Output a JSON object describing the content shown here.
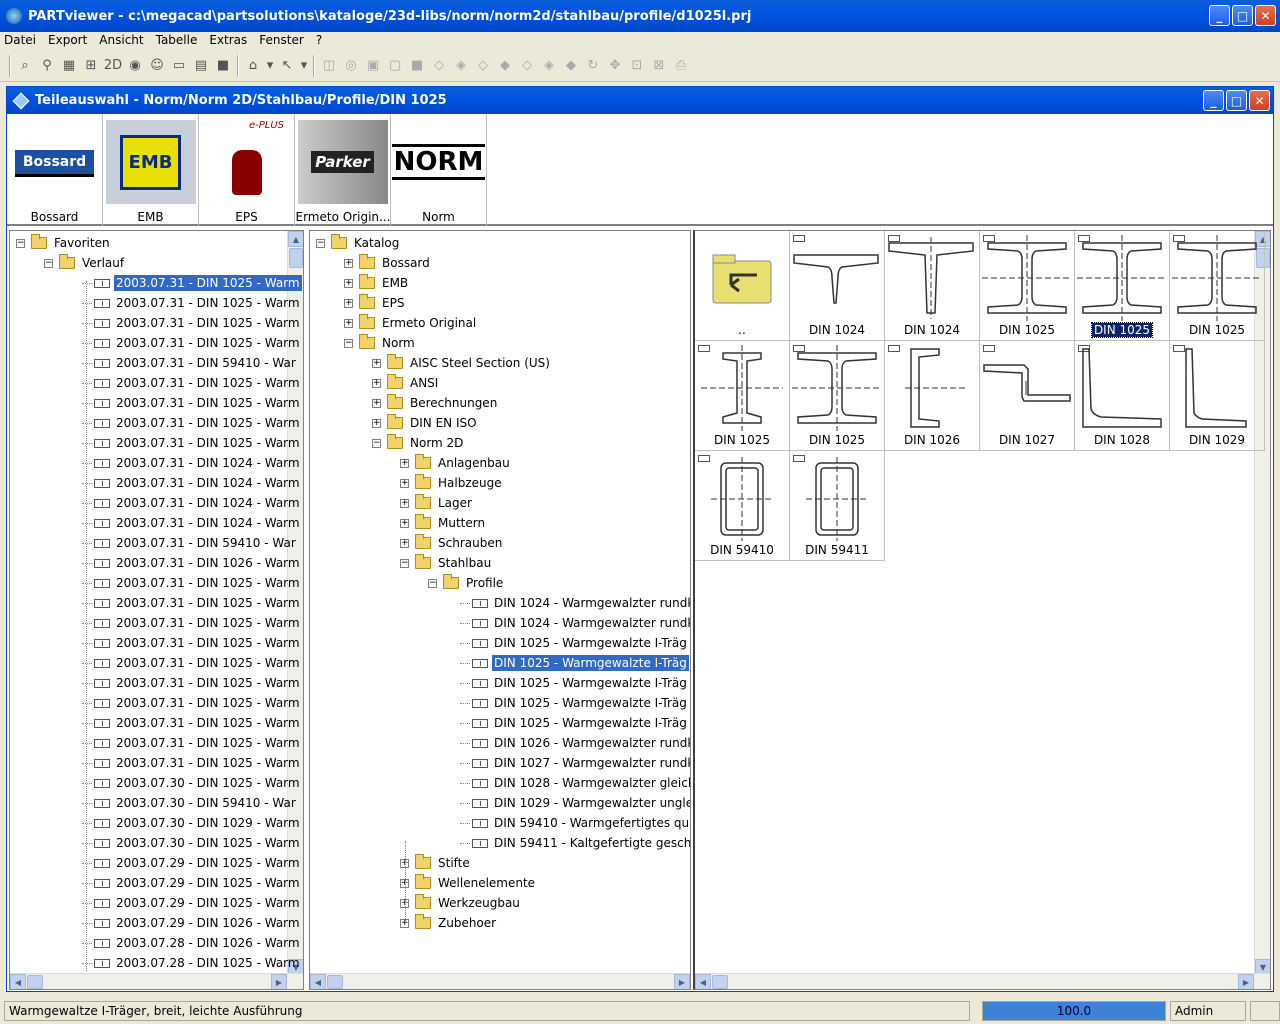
{
  "app": {
    "title": "PARTviewer - c:\\megacad\\partsolutions\\kataloge/23d-libs/norm/norm2d/stahlbau/profile/d1025l.prj"
  },
  "menu": [
    "Datei",
    "Export",
    "Ansicht",
    "Tabelle",
    "Extras",
    "Fenster",
    "?"
  ],
  "toolbar": {
    "icons": [
      "binoculars-icon",
      "filter-icon",
      "table-icon",
      "grid-icon",
      "2d-icon",
      "globe-icon",
      "person-icon",
      "disk-icon",
      "table2-icon",
      "stop-icon",
      "cad-icon",
      "dropdown-icon",
      "cursor-icon",
      "dropdown2-icon",
      "cylinder-icon",
      "cylinder2-icon",
      "box-icon",
      "box2-icon",
      "box3-icon",
      "view1-icon",
      "view2-icon",
      "view3-icon",
      "view4-icon",
      "view5-icon",
      "view6-icon",
      "view7-icon",
      "rotate-icon",
      "pan-icon",
      "zoom-window-icon",
      "zoom-all-icon",
      "print-icon"
    ]
  },
  "child_window": {
    "title": "Teileauswahl  -  Norm/Norm 2D/Stahlbau/Profile/DIN 1025"
  },
  "catalogs": [
    {
      "label": "Bossard",
      "logo": "Bossard"
    },
    {
      "label": "EMB",
      "logo": "EMB"
    },
    {
      "label": "EPS",
      "logo": "e-PLUS"
    },
    {
      "label": "Ermeto Origin...",
      "logo": "Parker"
    },
    {
      "label": "Norm",
      "logo": "NORM"
    }
  ],
  "favorites_tree": {
    "root": "Favoriten",
    "history": "Verlauf",
    "items": [
      "2003.07.31 - DIN 1025  -  Warm",
      "2003.07.31 - DIN 1025  -  Warm",
      "2003.07.31 - DIN 1025  -  Warm",
      "2003.07.31 - DIN 1025  -  Warm",
      "2003.07.31 - DIN 59410  -  War",
      "2003.07.31 - DIN 1025  -  Warm",
      "2003.07.31 - DIN 1025  -  Warm",
      "2003.07.31 - DIN 1025  -  Warm",
      "2003.07.31 - DIN 1025  -  Warm",
      "2003.07.31 - DIN 1024  -  Warm",
      "2003.07.31 - DIN 1024  -  Warm",
      "2003.07.31 - DIN 1024  -  Warm",
      "2003.07.31 - DIN 1024  -  Warm",
      "2003.07.31 - DIN 59410  -  War",
      "2003.07.31 - DIN 1026  -  Warm",
      "2003.07.31 - DIN 1025  -  Warm",
      "2003.07.31 - DIN 1025  -  Warm",
      "2003.07.31 - DIN 1025  -  Warm",
      "2003.07.31 - DIN 1025  -  Warm",
      "2003.07.31 - DIN 1025  -  Warm",
      "2003.07.31 - DIN 1025  -  Warm",
      "2003.07.31 - DIN 1025  -  Warm",
      "2003.07.31 - DIN 1025  -  Warm",
      "2003.07.31 - DIN 1025  -  Warm",
      "2003.07.31 - DIN 1025  -  Warm",
      "2003.07.30 - DIN 1025  -  Warm",
      "2003.07.30 - DIN 59410  -  War",
      "2003.07.30 - DIN 1029  -  Warm",
      "2003.07.30 - DIN 1025  -  Warm",
      "2003.07.29 - DIN 1025  -  Warm",
      "2003.07.29 - DIN 1025  -  Warm",
      "2003.07.29 - DIN 1025  -  Warm",
      "2003.07.29 - DIN 1026  -  Warm",
      "2003.07.28 - DIN 1026  -  Warm",
      "2003.07.28 - DIN 1025  -  Warm"
    ]
  },
  "catalog_tree": {
    "root": "Katalog",
    "level1": [
      "Bossard",
      "EMB",
      "EPS",
      "Ermeto Original",
      "Norm"
    ],
    "norm_children": [
      "AISC Steel Section (US)",
      "ANSI",
      "Berechnungen",
      "DIN EN ISO",
      "Norm 2D"
    ],
    "norm2d_children_top": [
      "Anlagenbau",
      "Halbzeuge",
      "Lager",
      "Muttern",
      "Schrauben",
      "Stahlbau"
    ],
    "stahlbau_children": [
      "Profile"
    ],
    "profile_items": [
      "DIN 1024  -  Warmgewalzter rundk",
      "DIN 1024  -  Warmgewalzter rundk",
      "DIN 1025  -  Warmgewalzte I-Träg",
      "DIN 1025  -  Warmgewalzte I-Träg",
      "DIN 1025  -  Warmgewalzte I-Träg",
      "DIN 1025  -  Warmgewalzte I-Träg",
      "DIN 1025  -  Warmgewalzte I-Träg",
      "DIN 1026  -  Warmgewalzter rundk",
      "DIN 1027  -  Warmgewalzter rundk",
      "DIN 1028  -  Warmgewalzter gleich",
      "DIN 1029  -  Warmgewalzter ungle",
      "DIN 59410  -  Warmgefertigtes qua",
      "DIN 59411  -  Kaltgefertigte gesch"
    ],
    "norm2d_children_bottom": [
      "Stifte",
      "Wellenelemente",
      "Werkzeugbau",
      "Zubehoer"
    ]
  },
  "parts_grid": [
    {
      "label": "..",
      "shape": "up"
    },
    {
      "label": "DIN 1024",
      "shape": "t1"
    },
    {
      "label": "DIN 1024",
      "shape": "t2"
    },
    {
      "label": "DIN 1025",
      "shape": "iwide"
    },
    {
      "label": "DIN 1025",
      "shape": "iwide",
      "selected": true
    },
    {
      "label": "DIN 1025",
      "shape": "iwide"
    },
    {
      "label": "DIN 1025",
      "shape": "inarrow"
    },
    {
      "label": "DIN 1025",
      "shape": "iwide"
    },
    {
      "label": "DIN 1026",
      "shape": "u"
    },
    {
      "label": "DIN 1027",
      "shape": "z"
    },
    {
      "label": "DIN 1028",
      "shape": "l1"
    },
    {
      "label": "DIN 1029",
      "shape": "l2"
    },
    {
      "label": "DIN 59410",
      "shape": "rect"
    },
    {
      "label": "DIN 59411",
      "shape": "rect"
    }
  ],
  "status": {
    "text": "Warmgewaltze I-Träger, breit, leichte Ausführung",
    "progress": "100.0",
    "progress_fraction": 1.0,
    "user": "Admin"
  },
  "colors": {
    "selection": "#316ac5",
    "titlebar": "#0054e3"
  }
}
